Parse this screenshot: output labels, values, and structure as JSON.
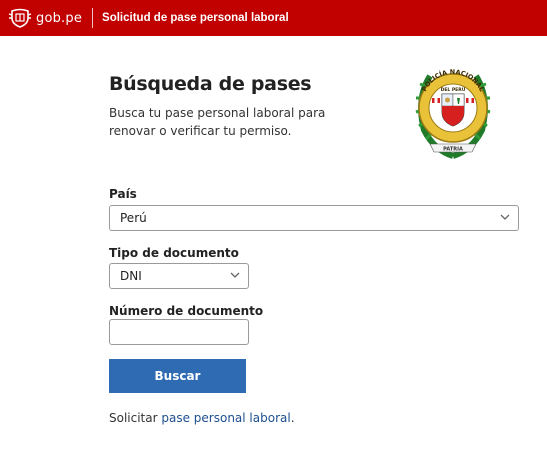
{
  "header": {
    "logo_text": "gob.pe",
    "app_title": "Solicitud de pase personal laboral"
  },
  "main": {
    "title": "Búsqueda de pases",
    "description": "Busca tu pase personal laboral para renovar o verificar tu permiso."
  },
  "emblem": {
    "icon": "policia-nacional-emblem-icon",
    "ring_top_text": "POLICÍA NACIONAL",
    "ring_mid_text": "DEL PERÚ",
    "ribbon_text": "PATRIA"
  },
  "form": {
    "country": {
      "label": "País",
      "value": "Perú"
    },
    "doc_type": {
      "label": "Tipo de documento",
      "value": "DNI"
    },
    "doc_number": {
      "label": "Número de documento",
      "value": "",
      "placeholder": ""
    },
    "submit_label": "Buscar"
  },
  "footer": {
    "prefix": "Solicitar ",
    "link_text": "pase personal laboral",
    "suffix": "."
  },
  "colors": {
    "header_bg": "#c10000",
    "button_bg": "#2e6bb2",
    "link": "#1e4f8f"
  }
}
